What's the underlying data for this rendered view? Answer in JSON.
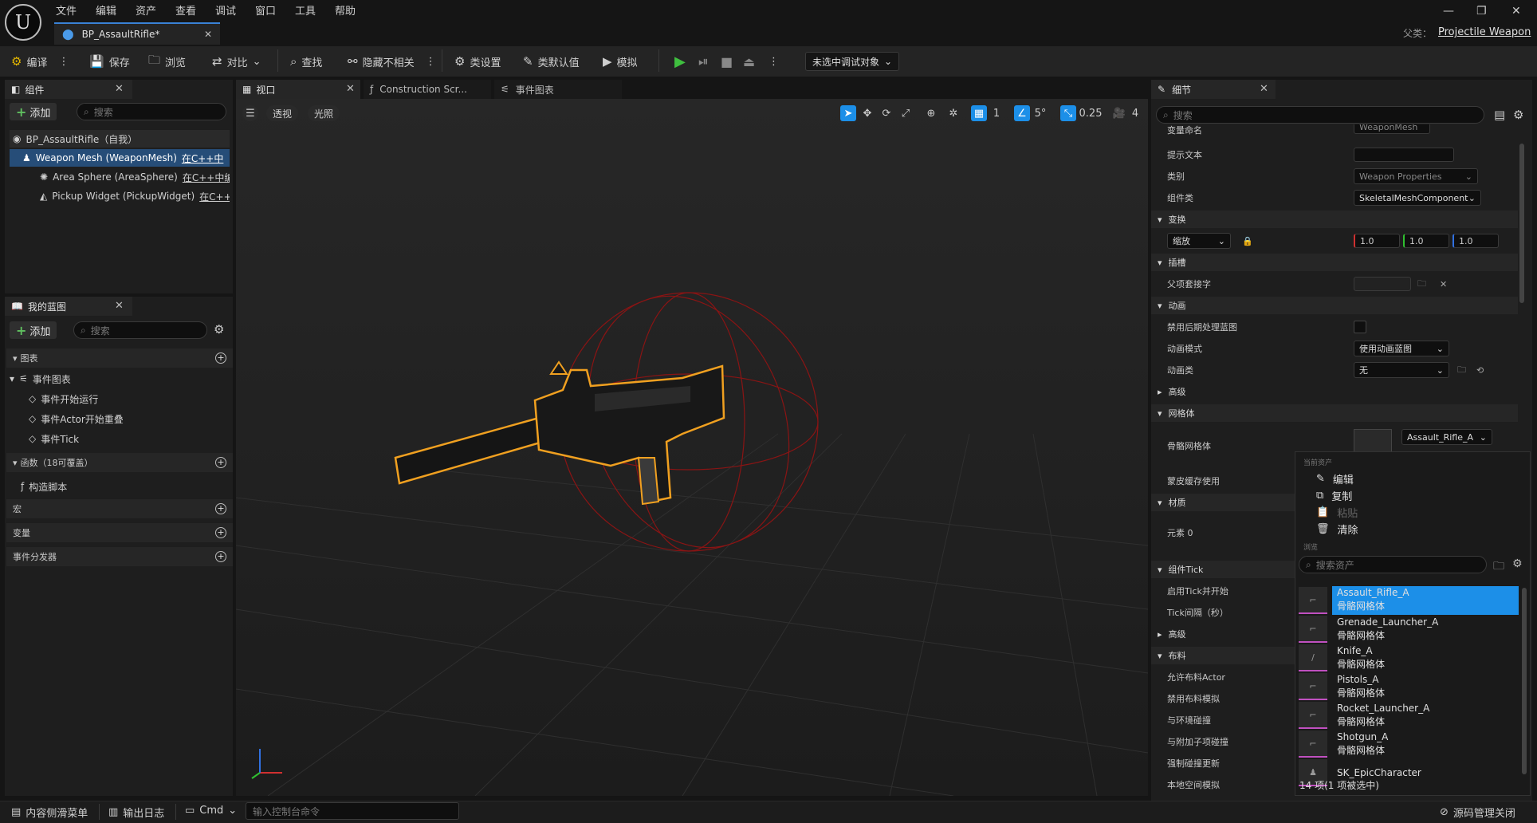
{
  "app": {
    "logo_glyph": "U",
    "menu": [
      "文件",
      "编辑",
      "资产",
      "查看",
      "调试",
      "窗口",
      "工具",
      "帮助"
    ],
    "doc_tab": "BP_AssaultRifle*",
    "parent_class_label": "父类：",
    "parent_class_value": "Projectile Weapon",
    "window_buttons": {
      "minimize": "—",
      "restore": "❐",
      "close": "✕"
    }
  },
  "toolbar": {
    "compile": "编译",
    "save": "保存",
    "browse": "浏览",
    "diff": "对比",
    "find": "查找",
    "hide_unrelated": "隐藏不相关",
    "class_settings": "类设置",
    "class_defaults": "类默认值",
    "simulate": "模拟",
    "debug_target": "未选中调试对象"
  },
  "components": {
    "tab": "组件",
    "add": "添加",
    "search_placeholder": "搜索",
    "root": "BP_AssaultRifle（自我）",
    "items": [
      {
        "name": "Weapon Mesh (WeaponMesh)",
        "tag": "在C++中"
      },
      {
        "name": "Area Sphere (AreaSphere)",
        "tag": "在C++中编"
      },
      {
        "name": "Pickup Widget (PickupWidget)",
        "tag": "在C++"
      }
    ]
  },
  "my_blueprint": {
    "tab": "我的蓝图",
    "add": "添加",
    "search_placeholder": "搜索",
    "graphs_header": "图表",
    "event_graph": "事件图表",
    "events": [
      "事件开始运行",
      "事件Actor开始重叠",
      "事件Tick"
    ],
    "functions_header": "函数（18可覆盖）",
    "construction": "构造脚本",
    "macros": "宏",
    "variables": "变量",
    "dispatchers": "事件分发器"
  },
  "viewport": {
    "tabs": [
      "视口",
      "Construction Scr...",
      "事件图表"
    ],
    "perspective": "透视",
    "lighting": "光照",
    "grid_value": "1",
    "angle_value": "5°",
    "scale_value": "0.25",
    "camera_speed": "4"
  },
  "details": {
    "tab": "细节",
    "search_placeholder": "搜索",
    "rows": {
      "var_name_label": "变量命名",
      "var_name_value": "WeaponMesh",
      "tooltip_label": "提示文本",
      "category_label": "类别",
      "category_value": "Weapon Properties",
      "component_class_label": "组件类",
      "component_class_value": "SkeletalMeshComponent"
    },
    "transform": {
      "header": "变换",
      "scale_label": "缩放",
      "x": "1.0",
      "y": "1.0",
      "z": "1.0"
    },
    "sockets": {
      "header": "插槽",
      "parent_socket": "父项套接字"
    },
    "animation": {
      "header": "动画",
      "disable_post": "禁用后期处理蓝图",
      "anim_mode": "动画模式",
      "anim_mode_value": "使用动画蓝图",
      "anim_class": "动画类",
      "anim_class_value": "无",
      "advanced": "高级"
    },
    "mesh": {
      "header": "网格体",
      "skeletal_mesh": "骨骼网格体",
      "skeletal_mesh_value": "Assault_Rifle_A",
      "skin_cache": "蒙皮缓存使用"
    },
    "materials": {
      "header": "材质",
      "element0": "元素 0"
    },
    "component_tick": {
      "header": "组件Tick",
      "start_with_tick": "启用Tick并开始",
      "tick_interval": "Tick间隔（秒）",
      "advanced": "高级"
    },
    "cloth": {
      "header": "布料",
      "rows": [
        "允许布料Actor",
        "禁用布料模拟",
        "与环境碰撞",
        "与附加子项碰撞",
        "强制碰撞更新",
        "本地空间模拟"
      ]
    }
  },
  "asset_picker": {
    "current_asset_label": "当前资产",
    "actions": [
      {
        "label": "编辑",
        "icon": "✎",
        "enabled": true
      },
      {
        "label": "复制",
        "icon": "⧉",
        "enabled": true
      },
      {
        "label": "粘贴",
        "icon": "📋",
        "enabled": false
      },
      {
        "label": "清除",
        "icon": "🗑",
        "enabled": true
      }
    ],
    "browse_label": "浏览",
    "search_placeholder": "搜索资产",
    "assets": [
      {
        "name": "Assault_Rifle_A",
        "type": "骨骼网格体",
        "selected": true
      },
      {
        "name": "Grenade_Launcher_A",
        "type": "骨骼网格体",
        "selected": false
      },
      {
        "name": "Knife_A",
        "type": "骨骼网格体",
        "selected": false
      },
      {
        "name": "Pistols_A",
        "type": "骨骼网格体",
        "selected": false
      },
      {
        "name": "Rocket_Launcher_A",
        "type": "骨骼网格体",
        "selected": false
      },
      {
        "name": "Shotgun_A",
        "type": "骨骼网格体",
        "selected": false
      },
      {
        "name": "SK_EpicCharacter",
        "type": "",
        "selected": false
      }
    ],
    "count": "14 项(1 项被选中)"
  },
  "statusbar": {
    "content_drawer": "内容侧滑菜单",
    "output_log": "输出日志",
    "cmd": "Cmd",
    "console_placeholder": "输入控制台命令",
    "source_control": "源码管理关闭"
  },
  "colors": {
    "accent": "#1c8fe8",
    "play": "#3fbf3f",
    "selection_outline": "#f0a020",
    "sphere": "#c01818"
  }
}
